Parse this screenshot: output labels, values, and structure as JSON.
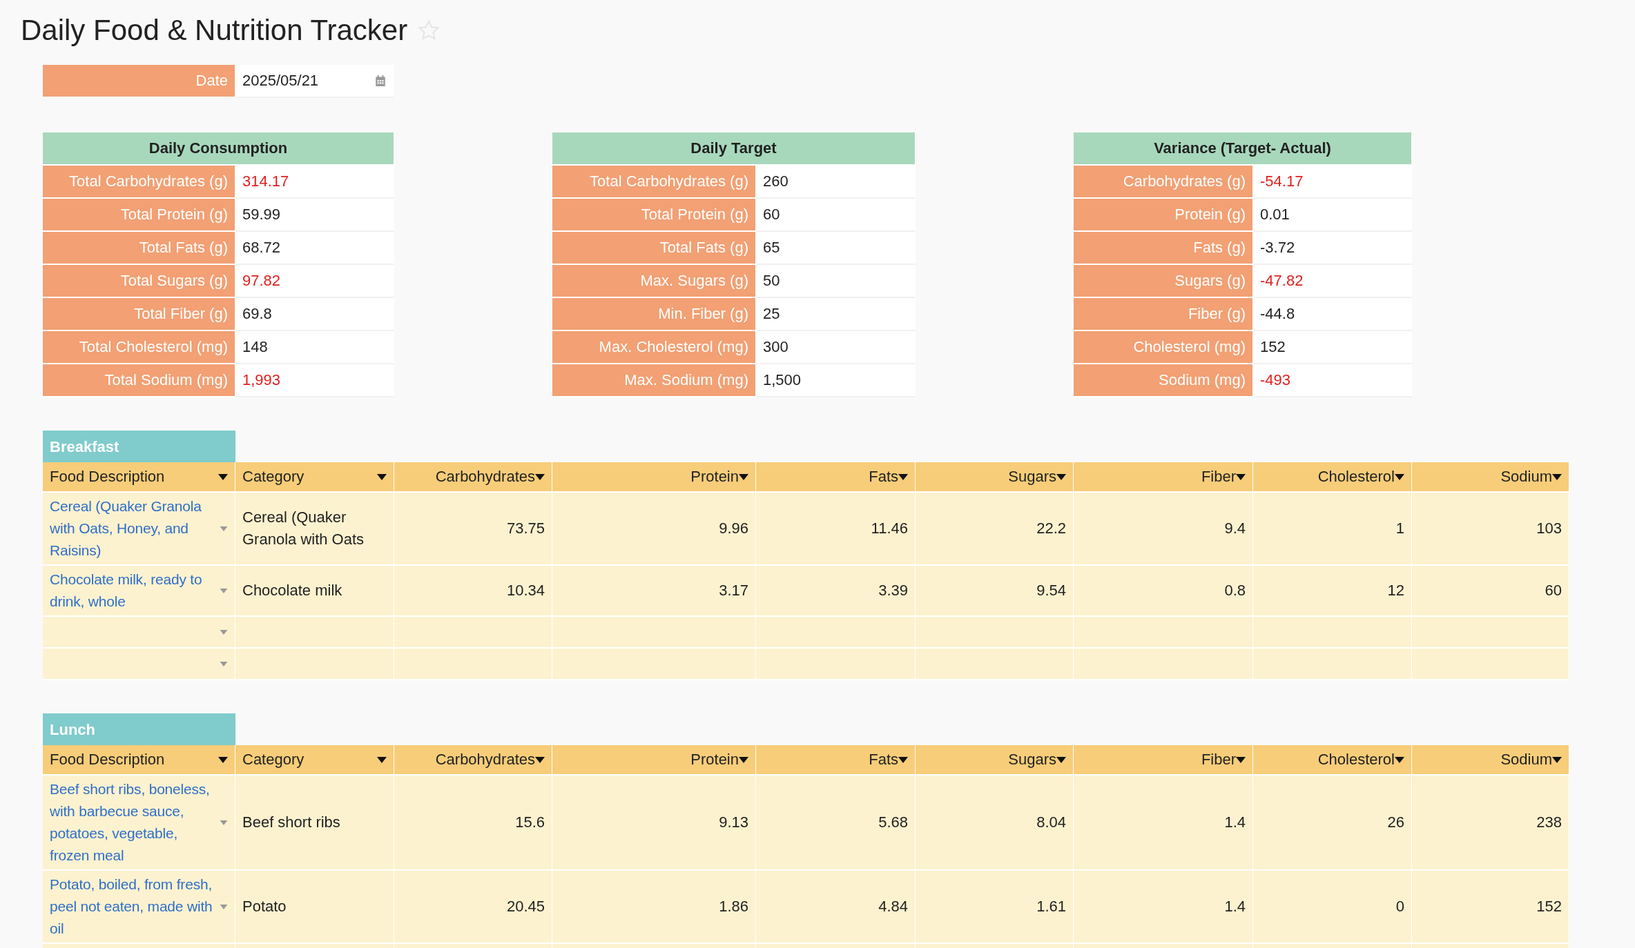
{
  "title": "Daily Food & Nutrition Tracker",
  "date": {
    "label": "Date",
    "value": "2025/05/21"
  },
  "summary": [
    {
      "title": "Daily Consumption",
      "rows": [
        {
          "label": "Total Carbohydrates (g)",
          "value": "314.17",
          "alert": true
        },
        {
          "label": "Total Protein (g)",
          "value": "59.99",
          "alert": false
        },
        {
          "label": "Total Fats (g)",
          "value": "68.72",
          "alert": false
        },
        {
          "label": "Total Sugars (g)",
          "value": "97.82",
          "alert": true
        },
        {
          "label": "Total Fiber (g)",
          "value": "69.8",
          "alert": false
        },
        {
          "label": "Total Cholesterol (mg)",
          "value": "148",
          "alert": false
        },
        {
          "label": "Total Sodium (mg)",
          "value": "1,993",
          "alert": true
        }
      ]
    },
    {
      "title": "Daily Target",
      "rows": [
        {
          "label": "Total Carbohydrates (g)",
          "value": "260",
          "alert": false
        },
        {
          "label": "Total Protein (g)",
          "value": "60",
          "alert": false
        },
        {
          "label": "Total Fats (g)",
          "value": "65",
          "alert": false
        },
        {
          "label": "Max. Sugars (g)",
          "value": "50",
          "alert": false
        },
        {
          "label": "Min. Fiber (g)",
          "value": "25",
          "alert": false
        },
        {
          "label": "Max. Cholesterol (mg)",
          "value": "300",
          "alert": false
        },
        {
          "label": "Max. Sodium (mg)",
          "value": "1,500",
          "alert": false
        }
      ]
    },
    {
      "title": "Variance (Target- Actual)",
      "rows": [
        {
          "label": "Carbohydrates (g)",
          "value": "-54.17",
          "alert": true
        },
        {
          "label": "Protein (g)",
          "value": "0.01",
          "alert": false
        },
        {
          "label": "Fats (g)",
          "value": "-3.72",
          "alert": false
        },
        {
          "label": "Sugars (g)",
          "value": "-47.82",
          "alert": true
        },
        {
          "label": "Fiber (g)",
          "value": "-44.8",
          "alert": false
        },
        {
          "label": "Cholesterol (mg)",
          "value": "152",
          "alert": false
        },
        {
          "label": "Sodium (mg)",
          "value": "-493",
          "alert": true
        }
      ]
    }
  ],
  "meals": [
    {
      "name": "Breakfast",
      "columns": [
        "Food Description",
        "Category",
        "Carbohydrates",
        "Protein",
        "Fats",
        "Sugars",
        "Fiber",
        "Cholesterol",
        "Sodium"
      ],
      "rows": [
        {
          "kind": "entry",
          "food": "Cereal (Quaker Granola with Oats, Honey, and Raisins)",
          "category": "Cereal (Quaker Granola with Oats",
          "values": [
            "73.75",
            "9.96",
            "11.46",
            "22.2",
            "9.4",
            "1",
            "103"
          ]
        },
        {
          "kind": "entry",
          "food": "Chocolate milk, ready to drink, whole",
          "category": "Chocolate milk",
          "values": [
            "10.34",
            "3.17",
            "3.39",
            "9.54",
            "0.8",
            "12",
            "60"
          ]
        },
        {
          "kind": "empty"
        },
        {
          "kind": "empty"
        }
      ]
    },
    {
      "name": "Lunch",
      "columns": [
        "Food Description",
        "Category",
        "Carbohydrates",
        "Protein",
        "Fats",
        "Sugars",
        "Fiber",
        "Cholesterol",
        "Sodium"
      ],
      "rows": [
        {
          "kind": "entry",
          "food": "Beef short ribs, boneless, with barbecue sauce, potatoes, vegetable, frozen meal",
          "category": "Beef short ribs",
          "values": [
            "15.6",
            "9.13",
            "5.68",
            "8.04",
            "1.4",
            "26",
            "238"
          ]
        },
        {
          "kind": "entry",
          "food": "Potato, boiled, from fresh, peel not eaten, made with oil",
          "category": "Potato",
          "values": [
            "20.45",
            "1.86",
            "4.84",
            "1.61",
            "1.4",
            "0",
            "152"
          ]
        },
        {
          "kind": "partial"
        }
      ]
    }
  ]
}
